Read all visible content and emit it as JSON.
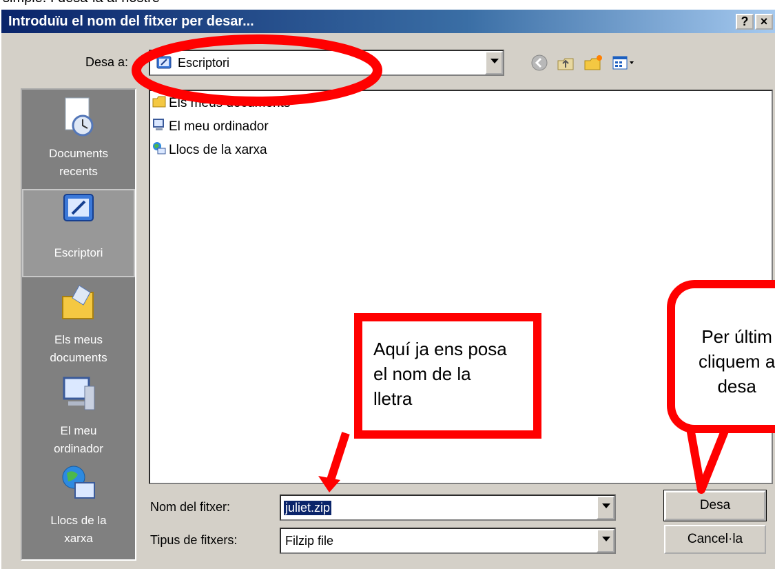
{
  "page_caption": "simple. I desa-la al nostre",
  "window": {
    "title": "Introduïu el nom del fitxer per desar...",
    "help_button": "?",
    "close_button": "×"
  },
  "save_in": {
    "label": "Desa a:",
    "value": "Escriptori"
  },
  "toolbar_icons": [
    "back-icon",
    "up-folder-icon",
    "new-folder-icon",
    "view-menu-icon"
  ],
  "places": [
    {
      "label_1": "Documents",
      "label_2": "recents"
    },
    {
      "label_1": "Escriptori",
      "label_2": ""
    },
    {
      "label_1": "Els meus",
      "label_2": "documents"
    },
    {
      "label_1": "El meu",
      "label_2": "ordinador"
    },
    {
      "label_1": "Llocs de la",
      "label_2": "xarxa"
    }
  ],
  "files": [
    "Els meus documents",
    "El meu ordinador",
    "Llocs de la xarxa"
  ],
  "filename": {
    "label": "Nom del fitxer:",
    "value": "juliet.zip"
  },
  "filetype": {
    "label": "Tipus de fitxers:",
    "value": "Filzip file"
  },
  "buttons": {
    "save": "Desa",
    "cancel": "Cancel·la"
  },
  "annotations": {
    "note_1": [
      "Aquí ja ens posa",
      "el nom de la",
      "lletra"
    ],
    "note_2": [
      "Per últim",
      "cliquem a",
      "desa"
    ],
    "color": "#ff0000"
  }
}
